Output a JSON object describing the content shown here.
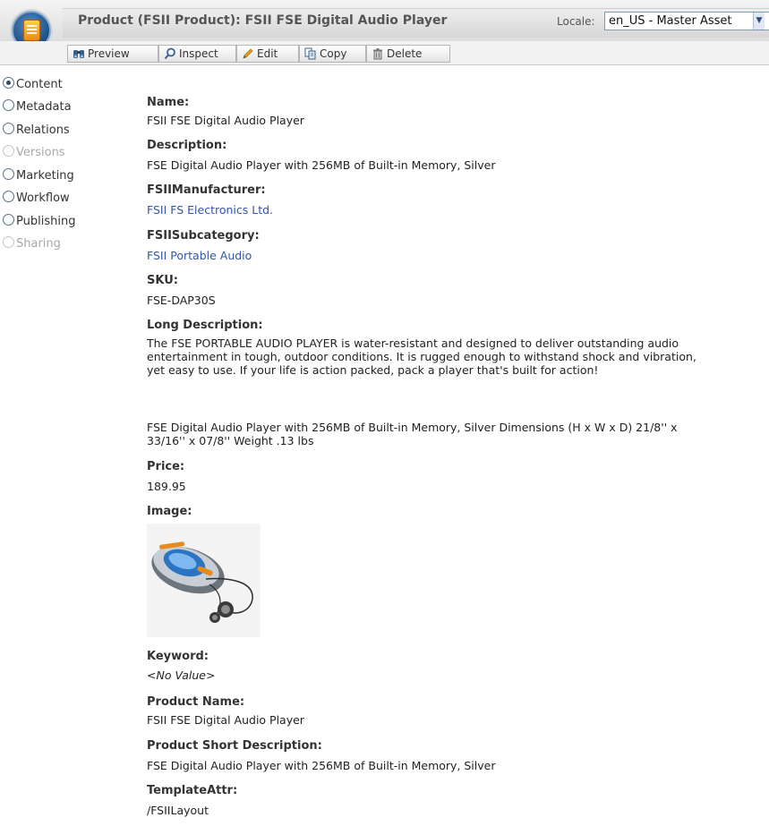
{
  "header": {
    "title": "Product (FSII Product): FSII FSE Digital Audio Player",
    "locale_label": "Locale:",
    "locale_value": "en_US - Master Asset"
  },
  "toolbar": {
    "preview": "Preview",
    "inspect": "Inspect",
    "edit": "Edit",
    "copy": "Copy",
    "delete": "Delete"
  },
  "sidebar": {
    "items": [
      {
        "label": "Content",
        "selected": true,
        "enabled": true
      },
      {
        "label": "Metadata",
        "selected": false,
        "enabled": true
      },
      {
        "label": "Relations",
        "selected": false,
        "enabled": true
      },
      {
        "label": "Versions",
        "selected": false,
        "enabled": false
      },
      {
        "label": "Marketing",
        "selected": false,
        "enabled": true
      },
      {
        "label": "Workflow",
        "selected": false,
        "enabled": true
      },
      {
        "label": "Publishing",
        "selected": false,
        "enabled": true
      },
      {
        "label": "Sharing",
        "selected": false,
        "enabled": false
      }
    ]
  },
  "fields": {
    "name": {
      "label": "Name:",
      "value": "FSII FSE Digital Audio Player"
    },
    "description": {
      "label": "Description:",
      "value": "FSE Digital Audio Player with 256MB of Built-in Memory, Silver"
    },
    "manufacturer": {
      "label": "FSIIManufacturer:",
      "value": "FSII FS Electronics Ltd."
    },
    "subcategory": {
      "label": "FSIISubcategory:",
      "value": "FSII Portable Audio"
    },
    "sku": {
      "label": "SKU:",
      "value": "FSE-DAP30S"
    },
    "long_description": {
      "label": "Long Description:",
      "paragraph1": "The FSE PORTABLE AUDIO PLAYER is water-resistant and designed to deliver outstanding audio entertainment in tough, outdoor conditions. It is rugged enough to withstand shock and vibration, yet easy to use. If your life is action packed, pack a player that's built for action!",
      "paragraph2": "FSE Digital Audio Player with 256MB of Built-in Memory, Silver Dimensions (H x W x D) 21/8'' x 33/16'' x 07/8'' Weight .13 lbs"
    },
    "price": {
      "label": "Price:",
      "value": "189.95"
    },
    "image": {
      "label": "Image:"
    },
    "keyword": {
      "label": "Keyword:",
      "value": "<No Value>"
    },
    "product_name": {
      "label": "Product Name:",
      "value": "FSII FSE Digital Audio Player"
    },
    "product_short_description": {
      "label": "Product Short Description:",
      "value": "FSE Digital Audio Player with 256MB of Built-in Memory, Silver"
    },
    "template_attr": {
      "label": "TemplateAttr:",
      "value": "/FSIILayout"
    }
  },
  "colors": {
    "link": "#3355aa",
    "disabled": "#a8a8a8",
    "label": "#333333"
  }
}
